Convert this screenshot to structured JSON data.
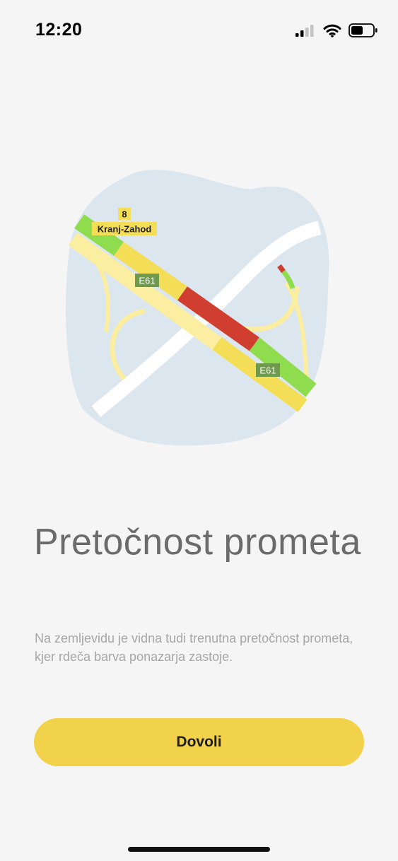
{
  "status_bar": {
    "time": "12:20",
    "icons": [
      "cellular-signal-icon",
      "wifi-icon",
      "battery-icon"
    ]
  },
  "map": {
    "road_number": "8",
    "exit_name": "Kranj-Zahod",
    "motorway_labels": [
      "E61",
      "E61"
    ],
    "colors": {
      "blob": "#dce6ee",
      "road": "#ffffff",
      "flow_free": "#8fdc4f",
      "flow_slow": "#f4dd57",
      "flow_jam": "#cf3e2e",
      "ramp": "#fbeea0",
      "shield": "#6f9a4e"
    }
  },
  "content": {
    "title": "Pretočnost prometa",
    "description": "Na zemljevidu je vidna tudi trenutna pretočnost prometa, kjer rdeča barva ponazarja zastoje."
  },
  "actions": {
    "allow_label": "Dovoli"
  },
  "colors": {
    "background": "#f5f5f5",
    "button": "#f1d24a",
    "title": "#6b6b6b",
    "description": "#a6a6a6"
  }
}
